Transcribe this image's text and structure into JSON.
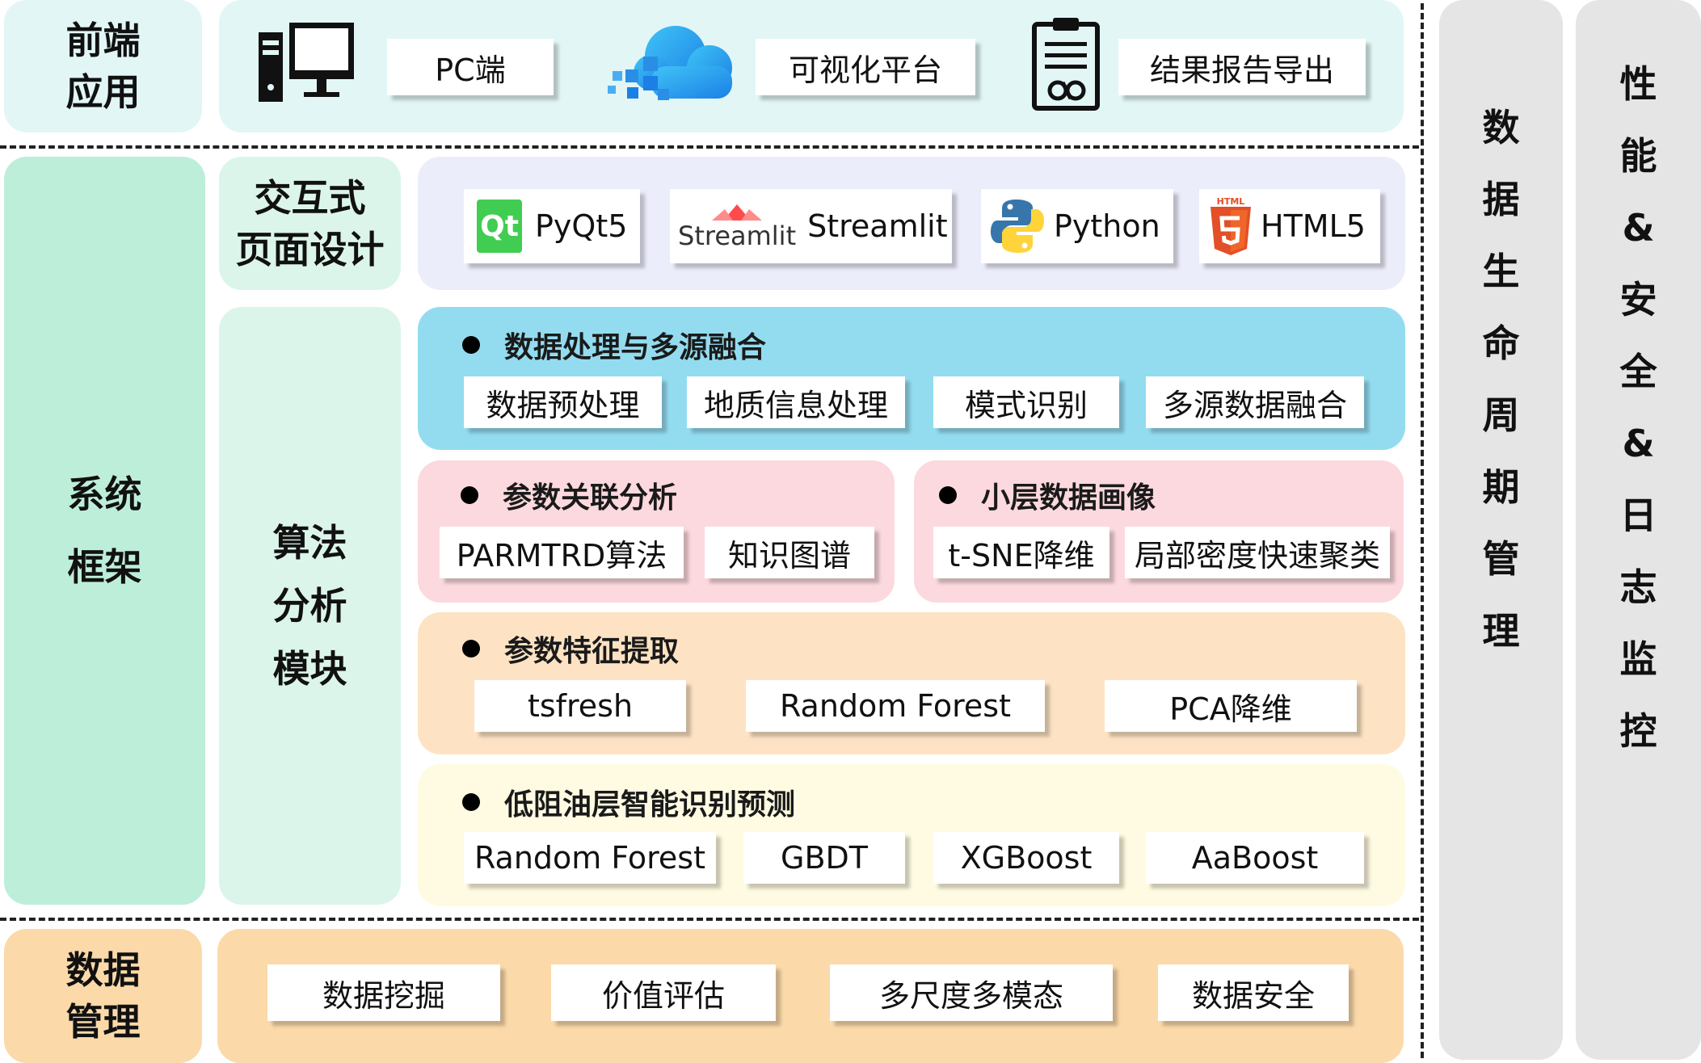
{
  "colors": {
    "frontend_bg": "#e2f6f6",
    "system_bg": "#bdeed9",
    "algo_bg": "#dcf5ea",
    "interactive_bg": "#ecedfa",
    "proc_bg": "#93dcf0",
    "pink_bg": "#fcd9de",
    "orange_bg": "#fde3c4",
    "yellow_bg": "#fefbe2",
    "data_mgmt_bg": "#fbd9a9",
    "side_bg": "#e5e5e5"
  },
  "frontend": {
    "label": "前端\n应用",
    "items": [
      {
        "icon": "desktop-computer-icon",
        "label": "PC端"
      },
      {
        "icon": "cloud-icon",
        "label": "可视化平台"
      },
      {
        "icon": "report-document-icon",
        "label": "结果报告导出"
      }
    ]
  },
  "system_framework": {
    "label": "系统\n框架"
  },
  "interactive": {
    "label": "交互式\n页面设计",
    "techs": [
      {
        "icon": "qt-logo-icon",
        "logo_text": "Qt",
        "label": "PyQt5"
      },
      {
        "icon": "streamlit-logo-icon",
        "logo_text": "Streamlit",
        "label": "Streamlit"
      },
      {
        "icon": "python-logo-icon",
        "label": "Python"
      },
      {
        "icon": "html5-logo-icon",
        "logo_text": "HTML",
        "label": "HTML5"
      }
    ]
  },
  "algorithm": {
    "label": "算法\n分析\n模块",
    "sections": {
      "processing": {
        "title": "数据处理与多源融合",
        "items": [
          "数据预处理",
          "地质信息处理",
          "模式识别",
          "多源数据融合"
        ]
      },
      "correlation": {
        "title": "参数关联分析",
        "items": [
          "PARMTRD算法",
          "知识图谱"
        ]
      },
      "profile": {
        "title": "小层数据画像",
        "items": [
          "t-SNE降维",
          "局部密度快速聚类"
        ]
      },
      "features": {
        "title": "参数特征提取",
        "items": [
          "tsfresh",
          "Random Forest",
          "PCA降维"
        ]
      },
      "prediction": {
        "title": "低阻油层智能识别预测",
        "items": [
          "Random Forest",
          "GBDT",
          "XGBoost",
          "AaBoost"
        ]
      }
    }
  },
  "data_management": {
    "label": "数据\n管理",
    "items": [
      "数据挖掘",
      "价值评估",
      "多尺度多模态",
      "数据安全"
    ]
  },
  "lifecycle": {
    "label": "数据生命周期管理"
  },
  "monitoring": {
    "label": "性能&安全&日志监控"
  }
}
